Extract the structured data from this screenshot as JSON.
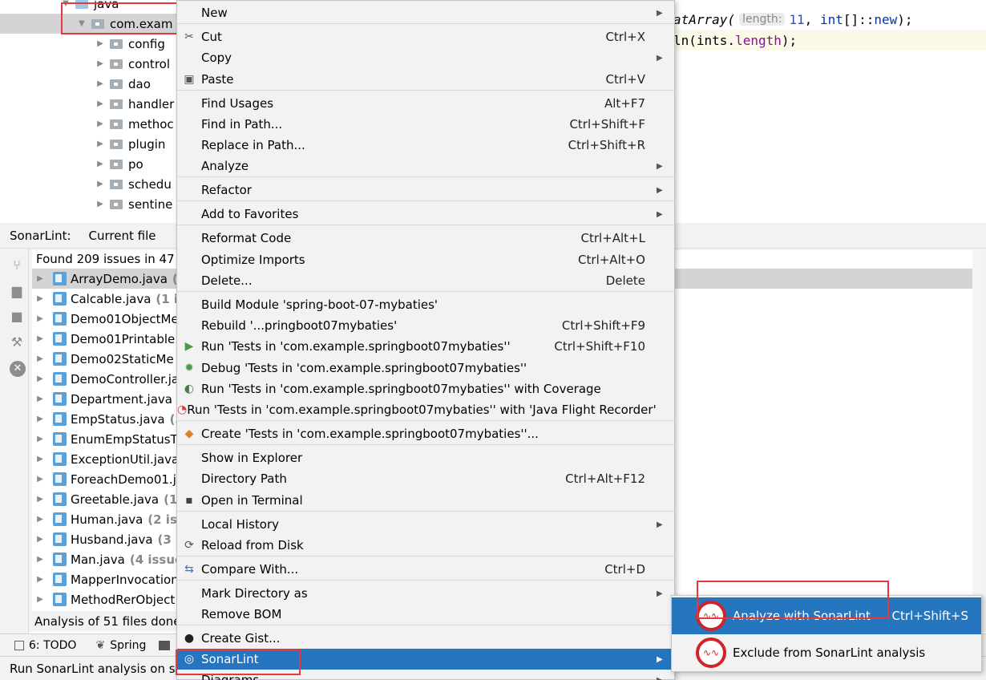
{
  "project_tree": {
    "java_label": "java",
    "selected_package": "com.exam",
    "folders": [
      "config",
      "control",
      "dao",
      "handler",
      "methoc",
      "plugin",
      "po",
      "schedu",
      "sentine"
    ]
  },
  "editor": {
    "line1": {
      "method_tail": "atArray(",
      "hint_label": "length:",
      "number": "11",
      "comma": ",",
      "kw_int": "int",
      "ref": "[]::",
      "kw_new": "new",
      "end": ");"
    },
    "line2": {
      "method_tail": "ln(ints.",
      "field": "length",
      "end": ");"
    }
  },
  "sonarlint_panel": {
    "title": "SonarLint:",
    "tab": "Current file",
    "found_text": "Found 209 issues in 47 fi",
    "files": [
      {
        "name": "ArrayDemo.java",
        "count": "("
      },
      {
        "name": "Calcable.java",
        "count": "(1 iss"
      },
      {
        "name": "Demo01ObjectMe",
        "count": ""
      },
      {
        "name": "Demo01Printable.",
        "count": ""
      },
      {
        "name": "Demo02StaticMe",
        "count": ""
      },
      {
        "name": "DemoController.ja",
        "count": ""
      },
      {
        "name": "Department.java",
        "count": "("
      },
      {
        "name": "EmpStatus.java",
        "count": "(3"
      },
      {
        "name": "EnumEmpStatusTy",
        "count": ""
      },
      {
        "name": "ExceptionUtil.java",
        "count": ""
      },
      {
        "name": "ForeachDemo01.j",
        "count": ""
      },
      {
        "name": "Greetable.java",
        "count": "(1"
      },
      {
        "name": "Human.java",
        "count": "(2 iss"
      },
      {
        "name": "Husband.java",
        "count": "(3 is"
      },
      {
        "name": "Man.java",
        "count": "(4 issue"
      },
      {
        "name": "MapperInvocation",
        "count": ""
      },
      {
        "name": "MethodRerObject",
        "count": ""
      }
    ],
    "analysis_text": "Analysis of 51 files done"
  },
  "bottom_tabs": {
    "todo": "6: TODO",
    "todo_mnemonic": "6",
    "spring": "Spring"
  },
  "status_bar": {
    "text": "Run SonarLint analysis on sel"
  },
  "context_menu": {
    "items": [
      {
        "label": "New",
        "shortcut": "",
        "submenu": true
      },
      {
        "label": "Cut",
        "shortcut": "Ctrl+X",
        "icon": "scissors-icon"
      },
      {
        "label": "Copy",
        "shortcut": "",
        "submenu": true
      },
      {
        "label": "Paste",
        "shortcut": "Ctrl+V",
        "icon": "clipboard-icon"
      },
      {
        "label": "Find Usages",
        "shortcut": "Alt+F7"
      },
      {
        "label": "Find in Path...",
        "shortcut": "Ctrl+Shift+F"
      },
      {
        "label": "Replace in Path...",
        "shortcut": "Ctrl+Shift+R"
      },
      {
        "label": "Analyze",
        "shortcut": "",
        "submenu": true
      },
      {
        "label": "Refactor",
        "shortcut": "",
        "submenu": true
      },
      {
        "label": "Add to Favorites",
        "shortcut": "",
        "submenu": true
      },
      {
        "label": "Reformat Code",
        "shortcut": "Ctrl+Alt+L"
      },
      {
        "label": "Optimize Imports",
        "shortcut": "Ctrl+Alt+O"
      },
      {
        "label": "Delete...",
        "shortcut": "Delete"
      },
      {
        "label": "Build Module 'spring-boot-07-mybaties'",
        "shortcut": ""
      },
      {
        "label": "Rebuild '...pringboot07mybaties'",
        "shortcut": "Ctrl+Shift+F9"
      },
      {
        "label": "Run 'Tests in 'com.example.springboot07mybaties''",
        "shortcut": "Ctrl+Shift+F10",
        "icon": "run-icon"
      },
      {
        "label": "Debug 'Tests in 'com.example.springboot07mybaties''",
        "shortcut": "",
        "icon": "debug-icon"
      },
      {
        "label": "Run 'Tests in 'com.example.springboot07mybaties'' with Coverage",
        "shortcut": "",
        "icon": "coverage-icon"
      },
      {
        "label": "Run 'Tests in 'com.example.springboot07mybaties'' with 'Java Flight Recorder'",
        "shortcut": "",
        "icon": "flight-recorder-icon"
      },
      {
        "label": "Create 'Tests in 'com.example.springboot07mybaties''...",
        "shortcut": "",
        "icon": "create-test-icon"
      },
      {
        "label": "Show in Explorer",
        "shortcut": ""
      },
      {
        "label": "Directory Path",
        "shortcut": "Ctrl+Alt+F12"
      },
      {
        "label": "Open in Terminal",
        "shortcut": "",
        "icon": "terminal-icon"
      },
      {
        "label": "Local History",
        "shortcut": "",
        "submenu": true
      },
      {
        "label": "Reload from Disk",
        "shortcut": "",
        "icon": "reload-icon"
      },
      {
        "label": "Compare With...",
        "shortcut": "Ctrl+D",
        "icon": "compare-icon"
      },
      {
        "label": "Mark Directory as",
        "shortcut": "",
        "submenu": true
      },
      {
        "label": "Remove BOM",
        "shortcut": ""
      },
      {
        "label": "Create Gist...",
        "shortcut": "",
        "icon": "github-icon"
      },
      {
        "label": "SonarLint",
        "shortcut": "",
        "submenu": true,
        "icon": "sonarlint-icon"
      },
      {
        "label": "Diagrams",
        "shortcut": "",
        "submenu": true
      }
    ]
  },
  "sonarlint_submenu": {
    "analyze_label": "Analyze with SonarLint",
    "analyze_shortcut": "Ctrl+Shift+S",
    "exclude_label": "Exclude from SonarLint analysis"
  },
  "colors": {
    "menu_highlight": "#2675bf",
    "annotation_red": "#e5393e",
    "sonar_red": "#d1232a"
  }
}
